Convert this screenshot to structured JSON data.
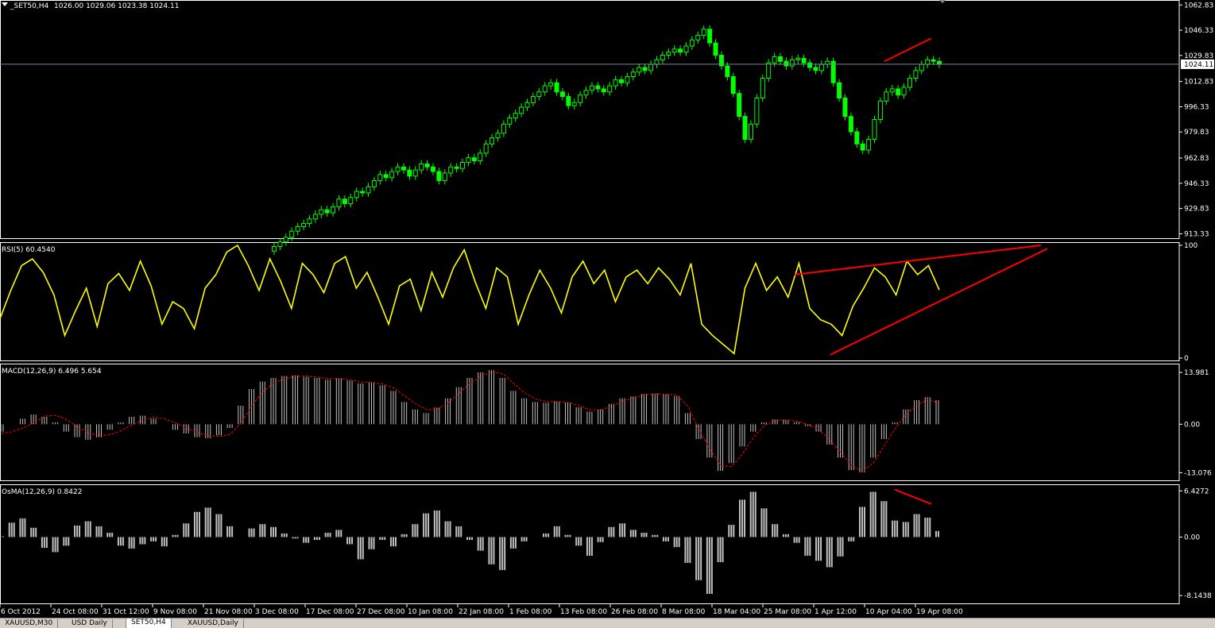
{
  "window": {
    "symbol_label": "_SET50,H4",
    "ohlc": "1026.00 1029.06 1023.38 1024.11",
    "current_price": "1024.11"
  },
  "tabs": [
    "XAUUSD,M30",
    "USD Daily",
    "SET50,H4",
    "XAUUSD,Daily"
  ],
  "active_tab": 2,
  "x_ticks": [
    "6 Oct 2012",
    "24 Oct 08:00",
    "31 Oct 12:00",
    "9 Nov 08:00",
    "21 Nov 08:00",
    "3 Dec 08:00",
    "17 Dec 08:00",
    "27 Dec 08:00",
    "10 Jan 08:00",
    "22 Jan 08:00",
    "1 Feb 08:00",
    "13 Feb 08:00",
    "26 Feb 08:00",
    "8 Mar 08:00",
    "18 Mar 04:00",
    "25 Mar 08:00",
    "1 Apr 12:00",
    "10 Apr 04:00",
    "19 Apr 08:00"
  ],
  "colors": {
    "background": "#000000",
    "candles": "#00ff00",
    "rsi": "#ffff00",
    "macd_bars": "#c0c0c0",
    "macd_signal": "#ff0000",
    "osma": "#c0c0c0",
    "trendline": "#ff0000",
    "text": "#ffffff"
  },
  "chart_data": [
    {
      "type": "candlestick",
      "title": "_SET50,H4",
      "y_ticks": [
        "1062.83",
        "1046.33",
        "1029.83",
        "1012.83",
        "996.33",
        "979.83",
        "962.83",
        "946.33",
        "929.83",
        "913.33"
      ],
      "ylim": [
        912,
        1064
      ],
      "current_price": 1024.11,
      "close": [
        905,
        908,
        911,
        915,
        918,
        920,
        923,
        926,
        929,
        927,
        931,
        936,
        933,
        937,
        941,
        940,
        944,
        948,
        952,
        950,
        954,
        957,
        955,
        951,
        955,
        959,
        957,
        954,
        948,
        953,
        957,
        956,
        960,
        963,
        961,
        966,
        972,
        976,
        979,
        985,
        989,
        992,
        996,
        999,
        1003,
        1006,
        1010,
        1012,
        1006,
        1003,
        997,
        999,
        1004,
        1007,
        1010,
        1008,
        1006,
        1010,
        1014,
        1012,
        1016,
        1019,
        1022,
        1020,
        1024,
        1027,
        1030,
        1032,
        1034,
        1032,
        1036,
        1040,
        1043,
        1047,
        1038,
        1030,
        1023,
        1016,
        1005,
        990,
        975,
        985,
        1002,
        1015,
        1025,
        1029,
        1026,
        1023,
        1027,
        1028,
        1025,
        1022,
        1020,
        1024,
        1026,
        1012,
        1002,
        990,
        980,
        972,
        968,
        975,
        988,
        1000,
        1006,
        1008,
        1004,
        1009,
        1015,
        1020,
        1024,
        1027,
        1026,
        1024.11
      ],
      "xlabel": "",
      "ylabel": "",
      "annotation": "red trendline rising across recent highs"
    },
    {
      "type": "line",
      "title": "RSI(5) 60.4540",
      "y_ticks": [
        "100",
        "0"
      ],
      "ylim": [
        0,
        100
      ],
      "values": [
        35,
        60,
        82,
        88,
        76,
        56,
        20,
        42,
        62,
        28,
        66,
        75,
        60,
        86,
        64,
        30,
        50,
        44,
        26,
        62,
        74,
        94,
        100,
        82,
        60,
        88,
        68,
        44,
        84,
        74,
        58,
        84,
        90,
        62,
        76,
        54,
        30,
        64,
        70,
        42,
        76,
        54,
        80,
        96,
        68,
        44,
        80,
        72,
        30,
        56,
        78,
        62,
        40,
        72,
        86,
        66,
        78,
        50,
        72,
        78,
        66,
        80,
        70,
        56,
        84,
        30,
        20,
        12,
        4,
        62,
        84,
        60,
        72,
        54,
        84,
        44,
        34,
        30,
        20,
        46,
        62,
        80,
        72,
        56,
        86,
        74,
        82,
        60.45
      ],
      "annotation": "red rising wedge trendlines"
    },
    {
      "type": "bar",
      "title": "MACD(12,26,9) 6.496 5.654",
      "y_ticks": [
        "13.981",
        "0.00",
        "-13.076"
      ],
      "ylim": [
        -14.5,
        15.5
      ],
      "series": [
        {
          "name": "MACD",
          "values": [
            -2,
            0,
            1.5,
            2.6,
            2,
            0.5,
            -2,
            -3.5,
            -4.2,
            -3.5,
            -1.5,
            0.5,
            2,
            2.3,
            1.5,
            0,
            -1.5,
            -2.5,
            -3.5,
            -3.8,
            -3,
            -1,
            5,
            9.5,
            11.5,
            12.5,
            13,
            13.2,
            12.8,
            12.5,
            12,
            12.4,
            11.8,
            11,
            11.2,
            10.5,
            9,
            6,
            4,
            3,
            4.5,
            7,
            10,
            12.5,
            14,
            14.6,
            12.5,
            9,
            7,
            6,
            5.8,
            6.2,
            5.8,
            4.6,
            3.4,
            4,
            5.5,
            7,
            7.5,
            8.2,
            8.3,
            8,
            7.6,
            3,
            -4,
            -9,
            -12.6,
            -10.5,
            -6,
            -2,
            0.5,
            1.3,
            1.2,
            0.6,
            -0.5,
            -2,
            -5.5,
            -9,
            -12.4,
            -13,
            -9,
            -4,
            0.5,
            4,
            6.5,
            7.3,
            6.496
          ]
        },
        {
          "name": "Signal",
          "values": [
            -2.5,
            -2,
            -1,
            0.5,
            2.2,
            2.4,
            1.2,
            -0.8,
            -2.4,
            -3.1,
            -2.8,
            -1.7,
            -0.2,
            1.2,
            1.9,
            1.4,
            0.3,
            -1.1,
            -2.3,
            -3.1,
            -3.3,
            -2.7,
            0.5,
            5.2,
            8.9,
            11.2,
            12.3,
            12.9,
            13,
            12.7,
            12.3,
            12.3,
            12,
            11.4,
            11.3,
            10.8,
            9.8,
            7.6,
            5.4,
            3.9,
            4.1,
            5.9,
            8.5,
            11.1,
            13,
            14.1,
            13.6,
            10.9,
            8.4,
            6.8,
            6.1,
            6.1,
            5.9,
            5,
            3.9,
            3.9,
            4.9,
            6.3,
            7.1,
            7.9,
            8.2,
            8.1,
            7.8,
            4.6,
            -1.6,
            -6.9,
            -11.2,
            -11.4,
            -7.8,
            -3.4,
            -0.3,
            1,
            1.2,
            0.8,
            -0.1,
            -1.5,
            -4.4,
            -7.8,
            -11.2,
            -12.7,
            -10.3,
            -5.6,
            -1,
            2.8,
            5.3,
            6.7,
            5.654
          ]
        }
      ]
    },
    {
      "type": "bar",
      "title": "OsMA(12,26,9) 0.8422",
      "y_ticks": [
        "6.4272",
        "0.00",
        "-8.1438"
      ],
      "ylim": [
        -8.9,
        6.9
      ],
      "values": [
        0.1,
        2,
        2.6,
        1.3,
        -1.5,
        -2.1,
        -1.2,
        1.6,
        2.2,
        1.5,
        0.6,
        -1.2,
        -1.6,
        -1,
        -0.6,
        -1.3,
        0.3,
        1.9,
        3.5,
        4.1,
        3.2,
        1.5,
        0,
        1.2,
        1.8,
        1.4,
        0.5,
        -0.2,
        -0.8,
        -0.4,
        0.6,
        1,
        -1,
        -3.1,
        -1.7,
        -0.4,
        -1.3,
        0.4,
        1.8,
        3.3,
        3.7,
        2.2,
        1.5,
        -0.4,
        -1.9,
        -3.8,
        -4.6,
        -1.6,
        -0.6,
        0,
        0.5,
        1.5,
        0.3,
        -1.2,
        -2.6,
        -0.7,
        1.4,
        1.9,
        1,
        0.6,
        0.3,
        -0.6,
        -1.4,
        -3.6,
        -6,
        -7.9,
        -3.5,
        1.7,
        5.2,
        6.3,
        4,
        1.8,
        0.4,
        -0.8,
        -2.6,
        -3.3,
        -4.2,
        -2.7,
        -0.6,
        4.2,
        6.3,
        5,
        2.3,
        2.1,
        3.2,
        2.7,
        0.8422
      ],
      "annotation": "red descending line on recent OsMA peaks"
    }
  ]
}
